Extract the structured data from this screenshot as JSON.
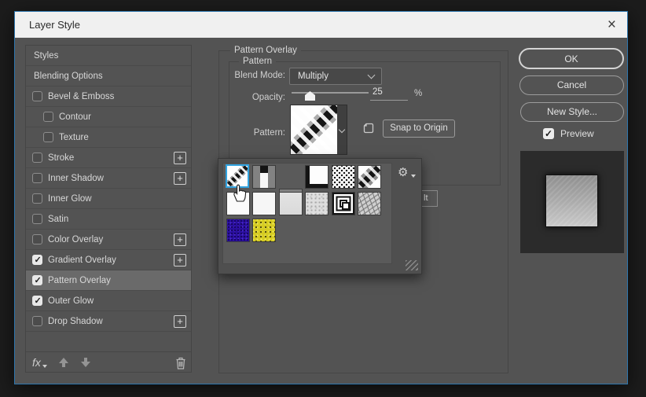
{
  "window": {
    "title": "Layer Style"
  },
  "icons": {
    "close": "×",
    "gear": "⚙",
    "fx": "fx"
  },
  "colors": {
    "desktop_bg": "#1c1c1c",
    "dialog_bg": "#535353",
    "dialog_border_accent": "#2e76ae",
    "titlebar_bg": "#f0f0f0",
    "selected_row_bg": "#6a6a6a",
    "swatch_selection_blue": "#31a3e0",
    "preview_panel_bg": "#2b2b2b"
  },
  "sidebar": {
    "items": [
      {
        "label": "Styles",
        "checkbox": false,
        "checked": false,
        "indent": false,
        "add": false,
        "selected": false
      },
      {
        "label": "Blending Options",
        "checkbox": false,
        "checked": false,
        "indent": false,
        "add": false,
        "selected": false
      },
      {
        "label": "Bevel & Emboss",
        "checkbox": true,
        "checked": false,
        "indent": false,
        "add": false,
        "selected": false
      },
      {
        "label": "Contour",
        "checkbox": true,
        "checked": false,
        "indent": true,
        "add": false,
        "selected": false
      },
      {
        "label": "Texture",
        "checkbox": true,
        "checked": false,
        "indent": true,
        "add": false,
        "selected": false
      },
      {
        "label": "Stroke",
        "checkbox": true,
        "checked": false,
        "indent": false,
        "add": true,
        "selected": false
      },
      {
        "label": "Inner Shadow",
        "checkbox": true,
        "checked": false,
        "indent": false,
        "add": true,
        "selected": false
      },
      {
        "label": "Inner Glow",
        "checkbox": true,
        "checked": false,
        "indent": false,
        "add": false,
        "selected": false
      },
      {
        "label": "Satin",
        "checkbox": true,
        "checked": false,
        "indent": false,
        "add": false,
        "selected": false
      },
      {
        "label": "Color Overlay",
        "checkbox": true,
        "checked": false,
        "indent": false,
        "add": true,
        "selected": false
      },
      {
        "label": "Gradient Overlay",
        "checkbox": true,
        "checked": true,
        "indent": false,
        "add": true,
        "selected": false
      },
      {
        "label": "Pattern Overlay",
        "checkbox": true,
        "checked": true,
        "indent": false,
        "add": false,
        "selected": true
      },
      {
        "label": "Outer Glow",
        "checkbox": true,
        "checked": true,
        "indent": false,
        "add": false,
        "selected": false
      },
      {
        "label": "Drop Shadow",
        "checkbox": true,
        "checked": false,
        "indent": false,
        "add": true,
        "selected": false
      }
    ],
    "footer": {
      "fx": "fx"
    }
  },
  "panel": {
    "legend_outer": "Pattern Overlay",
    "legend_inner": "Pattern",
    "blend_mode_label": "Blend Mode:",
    "blend_mode_value": "Multiply",
    "opacity_label": "Opacity:",
    "opacity_value": "25",
    "opacity_unit": "%",
    "pattern_label": "Pattern:",
    "snap_label": "Snap to Origin",
    "partial_button_visible_text": "lt"
  },
  "flyout": {
    "pattern_names": [
      "diagonal-dotted-line",
      "vertical-bar",
      "horizontal-bar",
      "corner-frame",
      "polka-dots",
      "diagonal-blocks",
      "white",
      "white",
      "light-gray",
      "fine-noise",
      "concentric-squares",
      "scribble-texture",
      "purple-noise",
      "yellow-noise"
    ],
    "selected_index": 0
  },
  "actions": {
    "ok": "OK",
    "cancel": "Cancel",
    "new_style": "New Style...",
    "preview": "Preview"
  }
}
